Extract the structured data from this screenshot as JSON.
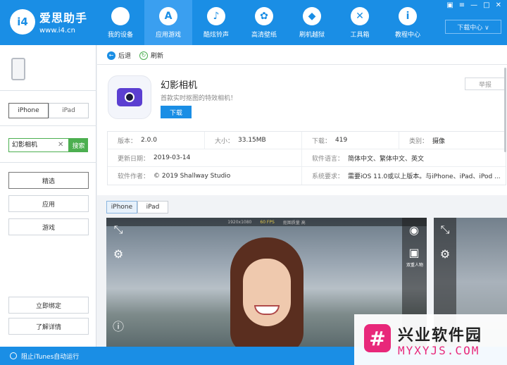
{
  "header": {
    "brand": "爱思助手",
    "url": "www.i4.cn",
    "logo_text": "i4",
    "nav": [
      {
        "label": "我的设备",
        "icon": "apple-icon"
      },
      {
        "label": "应用游戏",
        "icon": "app-store-icon"
      },
      {
        "label": "酷炫铃声",
        "icon": "bell-icon"
      },
      {
        "label": "高清壁纸",
        "icon": "flower-icon"
      },
      {
        "label": "刷机越狱",
        "icon": "box-icon"
      },
      {
        "label": "工具箱",
        "icon": "tools-icon"
      },
      {
        "label": "教程中心",
        "icon": "info-icon"
      }
    ],
    "active_nav": 1,
    "download_center": "下载中心 ∨"
  },
  "sidebar": {
    "device_tabs": [
      "iPhone",
      "iPad"
    ],
    "search_value": "幻影相机",
    "search_button": "搜索",
    "menu": [
      "精选",
      "应用",
      "游戏"
    ],
    "bottom_buttons": [
      "立即绑定",
      "了解详情"
    ]
  },
  "toolbar": {
    "back": "后退",
    "refresh": "刷新"
  },
  "app": {
    "name": "幻影相机",
    "description": "首款实时抠图的特效相机！",
    "download": "下载",
    "report": "举报",
    "info": {
      "version_key": "版本：",
      "version": "2.0.0",
      "size_key": "大小：",
      "size": "33.15MB",
      "downloads_key": "下载：",
      "downloads": "419",
      "category_key": "类别：",
      "category": "摄像",
      "updated_key": "更新日期：",
      "updated": "2019-03-14",
      "language_key": "软件语言：",
      "language": "简体中文、繁体中文、英文",
      "author_key": "软件作者：",
      "author": "© 2019 Shallway Studio",
      "requirements_key": "系统要求：",
      "requirements": "需要iOS 11.0或以上版本。与iPhone、iPad、iPod ..."
    }
  },
  "screenshots": {
    "tabs": [
      "iPhone",
      "iPad"
    ],
    "overlay": {
      "resolution": "1920x1080",
      "fps": "60 FPS",
      "quality": "抠图质量 高",
      "portrait_label": "双重人物"
    }
  },
  "status": {
    "itunes": "阻止iTunes自动运行"
  },
  "watermark": {
    "title": "兴业软件园",
    "url": "MYXYJS.COM"
  }
}
